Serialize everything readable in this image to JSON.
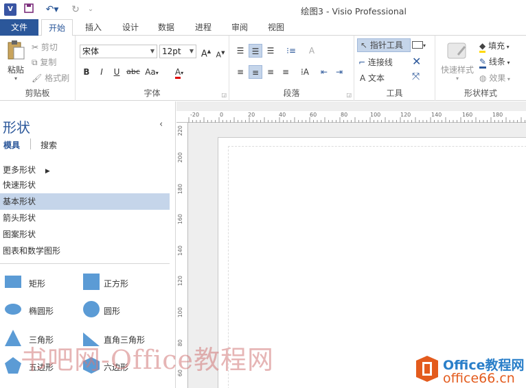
{
  "window": {
    "title": "绘图3 - Visio Professional",
    "app_icon": "V"
  },
  "quick_access": {
    "save_icon": "save-icon",
    "undo_icon": "undo-icon",
    "redo_icon": "redo-icon"
  },
  "tabs": {
    "file": "文件",
    "home": "开始",
    "insert": "插入",
    "design": "设计",
    "data": "数据",
    "process": "进程",
    "review": "审阅",
    "view": "视图"
  },
  "ribbon": {
    "clipboard": {
      "label": "剪贴板",
      "paste": "粘贴",
      "cut": "剪切",
      "copy": "复制",
      "format_painter": "格式刷"
    },
    "font": {
      "label": "字体",
      "font_name": "宋体",
      "font_size": "12pt",
      "bold": "B",
      "italic": "I",
      "underline": "U",
      "strikethrough": "abc",
      "case": "Aa",
      "color": "A"
    },
    "paragraph": {
      "label": "段落"
    },
    "tools": {
      "label": "工具",
      "pointer": "指针工具",
      "connector": "连接线",
      "text": "文本"
    },
    "shape_styles": {
      "label": "形状样式",
      "quick_styles": "快速样式",
      "fill": "填充",
      "line": "线条",
      "effects": "效果"
    }
  },
  "shapes_panel": {
    "title": "形状",
    "tab_stencils": "模具",
    "tab_search": "搜索",
    "more_shapes": "更多形状",
    "stencils": [
      "快速形状",
      "基本形状",
      "箭头形状",
      "图案形状",
      "图表和数学图形"
    ],
    "selected_stencil": "基本形状",
    "shapes": [
      "矩形",
      "正方形",
      "椭圆形",
      "圆形",
      "三角形",
      "直角三角形",
      "五边形",
      "六边形"
    ],
    "shape_color": "#5b9bd5"
  },
  "rulers": {
    "top": [
      "-20",
      "0",
      "20",
      "40",
      "60",
      "80",
      "100",
      "120",
      "140",
      "160",
      "180"
    ],
    "left": [
      "220",
      "200",
      "180",
      "160",
      "140",
      "120",
      "100",
      "80",
      "60"
    ]
  },
  "watermark": {
    "text": "书吧网-Office教程网",
    "logo_top": "Office教程网",
    "logo_bottom": "office66.cn"
  }
}
